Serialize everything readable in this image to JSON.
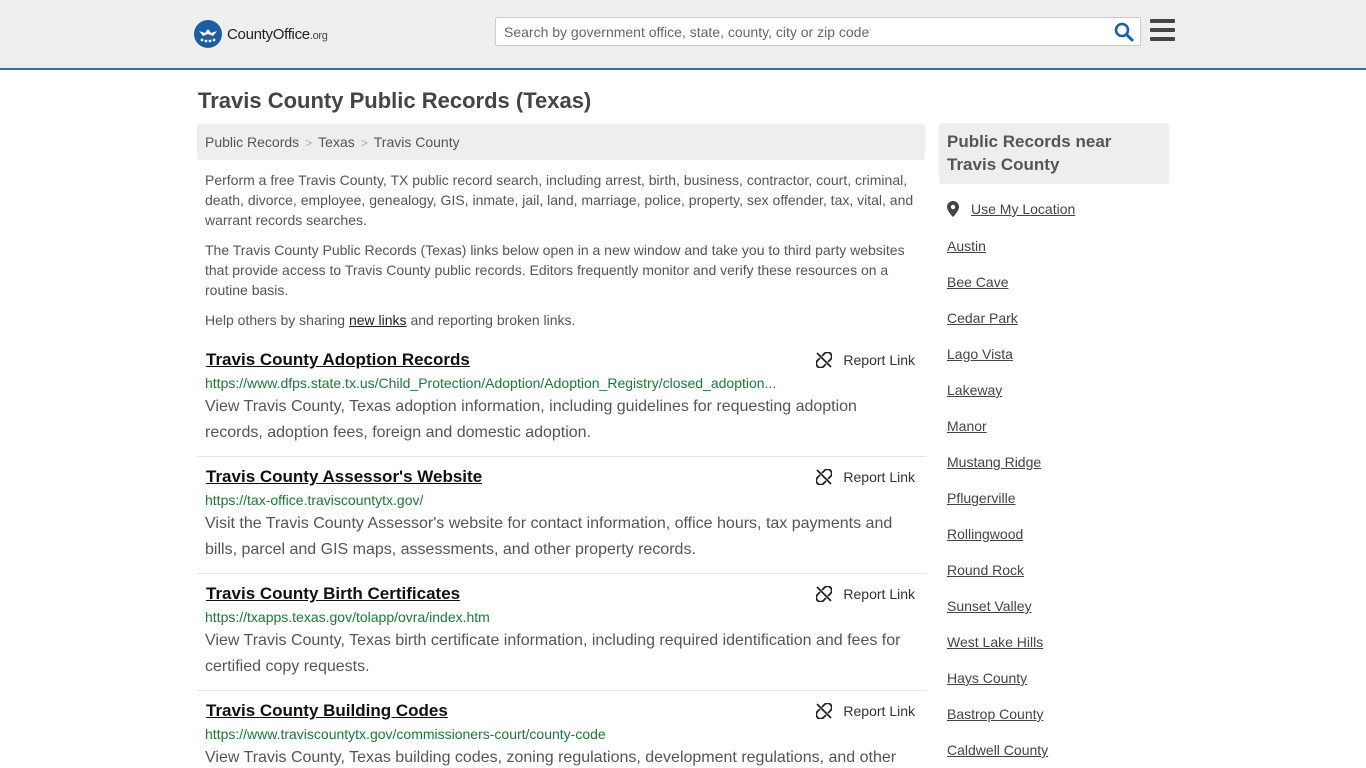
{
  "header": {
    "logo": {
      "brand": "CountyOffice",
      "tld": ".org"
    },
    "search": {
      "placeholder": "Search by government office, state, county, city or zip code"
    },
    "icons": {
      "search": "search-icon",
      "menu": "hamburger-menu-icon",
      "logo": "eagle-logo-icon"
    },
    "accent_color": "#2b74b4"
  },
  "page": {
    "title": "Travis County Public Records (Texas)",
    "breadcrumb": [
      "Public Records",
      "Texas",
      "Travis County"
    ],
    "intro": {
      "p1": "Perform a free Travis County, TX public record search, including arrest, birth, business, contractor, court, criminal, death, divorce, employee, genealogy, GIS, inmate, jail, land, marriage, police, property, sex offender, tax, vital, and warrant records searches.",
      "p2": "The Travis County Public Records (Texas) links below open in a new window and take you to third party websites that provide access to Travis County public records. Editors frequently monitor and verify these resources on a routine basis.",
      "p3_before": "Help others by sharing",
      "p3_link": "new links",
      "p3_after": "and reporting broken links."
    }
  },
  "records": [
    {
      "title": "Travis County Adoption Records",
      "url": "https://www.dfps.state.tx.us/Child_Protection/Adoption/Adoption_Registry/closed_adoption...",
      "desc": "View Travis County, Texas adoption information, including guidelines for requesting adoption records, adoption fees, foreign and domestic adoption.",
      "report": "Report Link"
    },
    {
      "title": "Travis County Assessor's Website",
      "url": "https://tax-office.traviscountytx.gov/",
      "desc": "Visit the Travis County Assessor's website for contact information, office hours, tax payments and bills, parcel and GIS maps, assessments, and other property records.",
      "report": "Report Link"
    },
    {
      "title": "Travis County Birth Certificates",
      "url": "https://txapps.texas.gov/tolapp/ovra/index.htm",
      "desc": "View Travis County, Texas birth certificate information, including required identification and fees for certified copy requests.",
      "report": "Report Link"
    },
    {
      "title": "Travis County Building Codes",
      "url": "https://www.traviscountytx.gov/commissioners-court/county-code",
      "desc": "View Travis County, Texas building codes, zoning regulations, development regulations, and other",
      "report": "Report Link"
    }
  ],
  "sidebar": {
    "heading": "Public Records near Travis County",
    "use_location": "Use My Location",
    "places": [
      "Austin",
      "Bee Cave",
      "Cedar Park",
      "Lago Vista",
      "Lakeway",
      "Manor",
      "Mustang Ridge",
      "Pflugerville",
      "Rollingwood",
      "Round Rock",
      "Sunset Valley",
      "West Lake Hills",
      "Hays County",
      "Bastrop County",
      "Caldwell County"
    ]
  }
}
